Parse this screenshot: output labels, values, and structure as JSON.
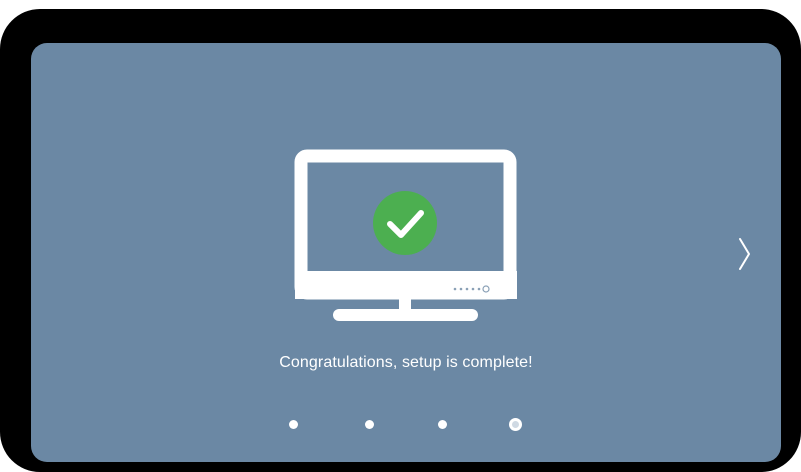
{
  "screen": {
    "background": "#6b88a4",
    "message": "Congratulations, setup is complete!"
  },
  "illustration": {
    "icon": "monitor-icon",
    "badge_icon": "checkmark-icon",
    "badge_color": "#4caf50"
  },
  "navigation": {
    "next_icon": "chevron-right-icon"
  },
  "pager": {
    "total_pages": 4,
    "current_page": 4
  }
}
